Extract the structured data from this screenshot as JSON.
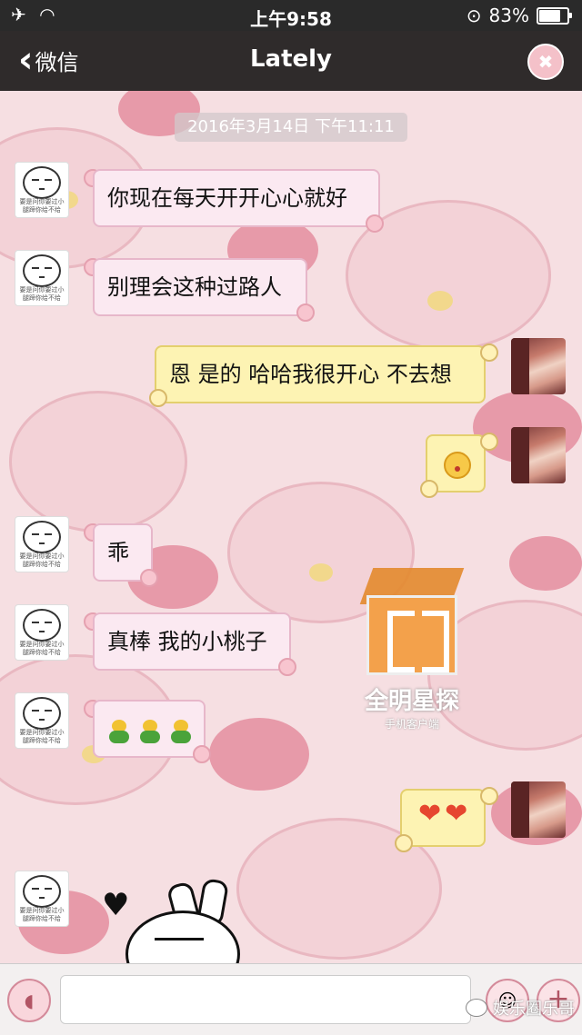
{
  "status_bar": {
    "airplane_icon": "airplane-icon",
    "wifi_icon": "wifi-icon",
    "time": "上午9:58",
    "battery_percent": "83%",
    "battery_level": 0.83
  },
  "nav": {
    "back_label": "微信",
    "title": "Lately",
    "avatar_icon": "chopper-avatar-icon"
  },
  "chat": {
    "timestamp": "2016年3月14日 下午11:11",
    "messages": [
      {
        "side": "in",
        "text": "你现在每天开开心心就好"
      },
      {
        "side": "in",
        "text": "别理会这种过路人"
      },
      {
        "side": "out",
        "text": "恩 是的 哈哈我很开心 不去想"
      },
      {
        "side": "out",
        "emoji": "kiss-emoji-icon"
      },
      {
        "side": "in",
        "text": "乖"
      },
      {
        "side": "in",
        "text": "真棒 我的小桃子"
      },
      {
        "side": "in",
        "emoji": "sprout-emoji-icon",
        "count": 3
      },
      {
        "side": "out",
        "emoji": "heart-icon",
        "count": 2
      },
      {
        "side": "in",
        "sticker": "rabbit-sticker"
      }
    ],
    "avatar_caption": "要是问你要过小腿蹄你给不给"
  },
  "watermark": {
    "text": "全明星探",
    "sub": "手机客户端"
  },
  "input_bar": {
    "placeholder": "",
    "voice_icon": "voice-icon",
    "emoji_icon": "emoji-icon",
    "plus_icon": "plus-icon"
  },
  "source_mark": {
    "text": "娱乐圈乐哥"
  },
  "colors": {
    "incoming_bubble": "#fbe9f1",
    "outgoing_bubble": "#fdf3b3",
    "nav_bg": "#2f2b2b"
  }
}
